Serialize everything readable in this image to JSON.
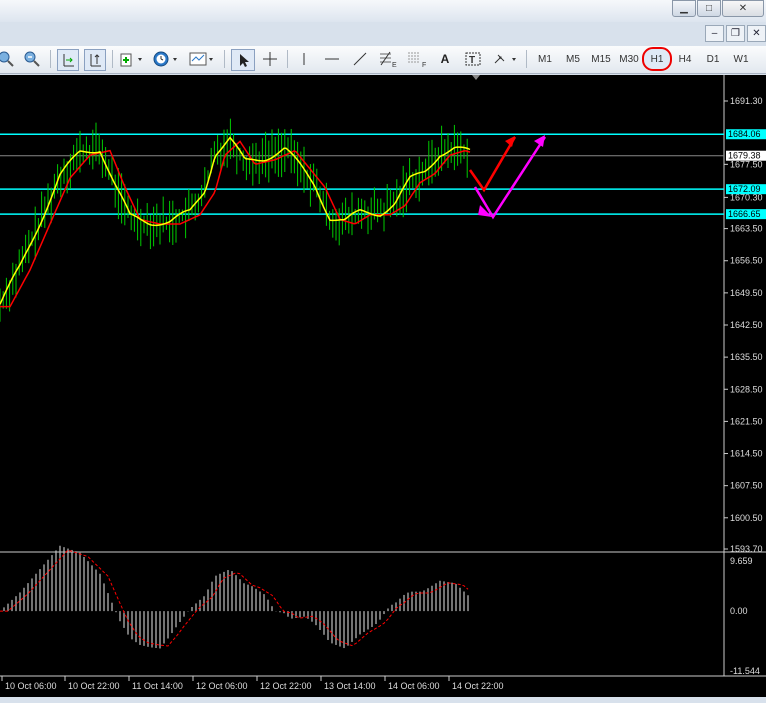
{
  "window": {
    "minimize_icon": "minimize-icon",
    "maximize_icon": "maximize-icon",
    "close_icon": "close-icon"
  },
  "toolbar": {
    "timeframes": [
      {
        "label": "M1"
      },
      {
        "label": "M5"
      },
      {
        "label": "M15"
      },
      {
        "label": "M30"
      },
      {
        "label": "H1",
        "selected": true
      },
      {
        "label": "H4"
      },
      {
        "label": "D1"
      },
      {
        "label": "W1"
      }
    ],
    "text_tool_label": "A",
    "textlabel_tool_label": "T",
    "fibo_e_label": "E",
    "fibo_f_label": "F"
  },
  "chart_data": {
    "type": "line",
    "series": [],
    "price_axis": {
      "ticks": [
        "1691.30",
        "1677.50",
        "1670.30",
        "1663.50",
        "1656.50",
        "1649.50",
        "1642.50",
        "1635.50",
        "1628.50",
        "1621.50",
        "1614.50",
        "1607.50",
        "1600.50",
        "1593.70"
      ],
      "ylim": [
        1593.7,
        1691.3
      ]
    },
    "price_labels": {
      "current": "1679.38",
      "levels": [
        "1684.06",
        "1672.09",
        "1666.65"
      ]
    },
    "time_axis": {
      "ticks": [
        "10 Oct 06:00",
        "10 Oct 22:00",
        "11 Oct 14:00",
        "12 Oct 06:00",
        "12 Oct 22:00",
        "13 Oct 14:00",
        "14 Oct 06:00",
        "14 Oct 22:00"
      ]
    },
    "indicator": {
      "ticks": [
        "9.659",
        "0.00",
        "-11.544"
      ],
      "ylim": [
        -11.544,
        9.659
      ]
    },
    "colors": {
      "background": "#000000",
      "candles": "#00cc00",
      "fast_ma": "#ffff00",
      "slow_ma": "#ff0000",
      "levels": "#00ffff",
      "arrow_up_red": "#ff0000",
      "arrow_magenta": "#ff00ff",
      "histogram": "#c0c0c0"
    }
  }
}
